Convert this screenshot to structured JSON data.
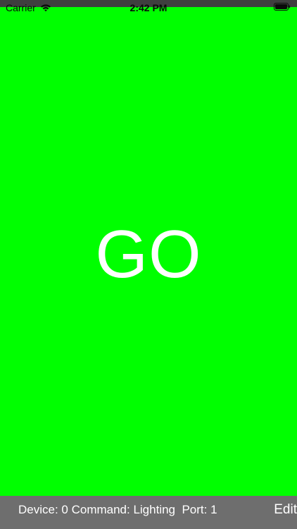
{
  "status_bar": {
    "carrier": "Carrier",
    "time": "2:42 PM",
    "wifi_icon": "wifi-icon",
    "battery_icon": "battery-icon"
  },
  "main": {
    "label": "GO",
    "background_color": "#00ff00",
    "text_color": "#ffffff"
  },
  "bottom_bar": {
    "info": "Device: 0 Command: Lighting  Port: 1",
    "edit_label": "Edit",
    "background_color": "#6e6e6e"
  }
}
